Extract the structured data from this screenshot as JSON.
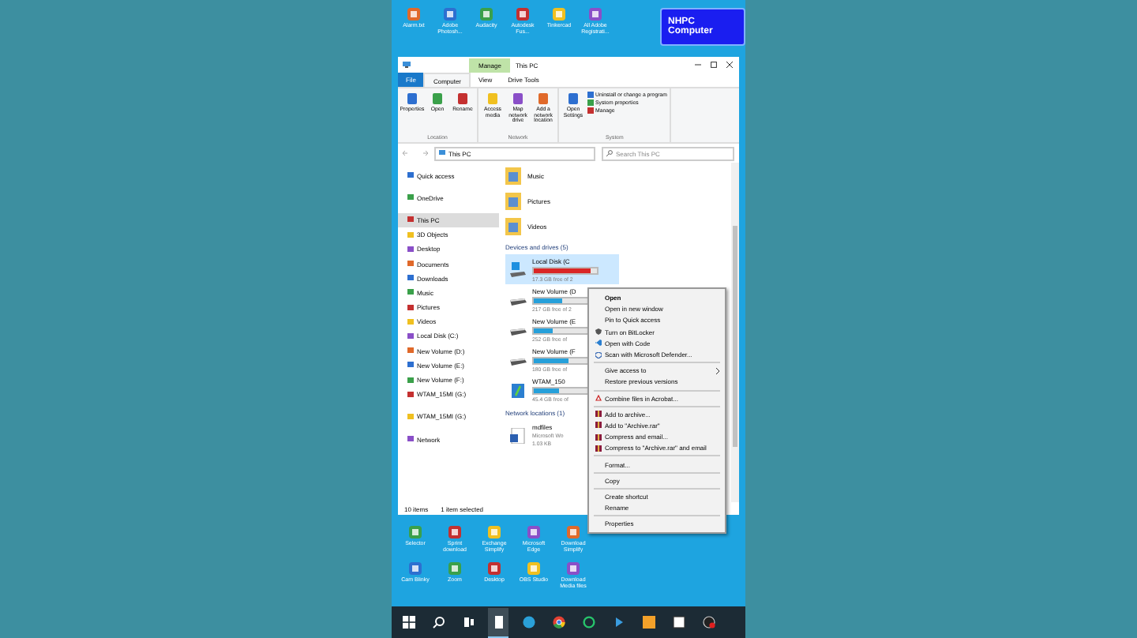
{
  "badge": "NHPC Computer",
  "desktop_top": [
    {
      "label": "Alarm.txt"
    },
    {
      "label": "Adobe Photosh..."
    },
    {
      "label": "Audacity"
    },
    {
      "label": "Autodesk Fus..."
    },
    {
      "label": "Tinkercad"
    },
    {
      "label": "All Adobe Registrati..."
    }
  ],
  "window": {
    "title": "This PC",
    "context_tab": "Manage",
    "tabs": [
      {
        "label": "File",
        "selected": false,
        "kind": "file"
      },
      {
        "label": "Computer",
        "selected": true,
        "kind": "tab"
      },
      {
        "label": "View",
        "selected": false,
        "kind": "tab"
      },
      {
        "label": "Drive Tools",
        "selected": false,
        "kind": "tab"
      }
    ],
    "ribbon_groups": [
      {
        "name": "Location",
        "buttons": [
          "Properties",
          "Open",
          "Rename"
        ]
      },
      {
        "name": "Network",
        "buttons": [
          "Access media",
          "Map network drive",
          "Add a network location"
        ]
      },
      {
        "name": "System",
        "buttons": [
          "Open Settings"
        ],
        "links": [
          "Uninstall or change a program",
          "System properties",
          "Manage"
        ]
      }
    ],
    "address": "This PC",
    "search": {
      "placeholder": "Search This PC"
    },
    "nav": [
      {
        "label": "Quick access",
        "selected": false
      },
      {
        "label": "OneDrive",
        "selected": false
      },
      {
        "label": "This PC",
        "selected": true
      },
      {
        "label": "3D Objects",
        "selected": false
      },
      {
        "label": "Desktop",
        "selected": false
      },
      {
        "label": "Documents",
        "selected": false
      },
      {
        "label": "Downloads",
        "selected": false
      },
      {
        "label": "Music",
        "selected": false
      },
      {
        "label": "Pictures",
        "selected": false
      },
      {
        "label": "Videos",
        "selected": false
      },
      {
        "label": "Local Disk (C:)",
        "selected": false
      },
      {
        "label": "New Volume (D:)",
        "selected": false
      },
      {
        "label": "New Volume (E:)",
        "selected": false
      },
      {
        "label": "New Volume (F:)",
        "selected": false
      },
      {
        "label": "WTAM_15MI (G:)",
        "selected": false
      },
      {
        "label": "WTAM_15MI (G:)",
        "selected": false
      },
      {
        "label": "Network",
        "selected": false
      }
    ],
    "folders": [
      {
        "label": "Music"
      },
      {
        "label": "Pictures"
      },
      {
        "label": "Videos"
      }
    ],
    "drives_heading": "Devices and drives (5)",
    "drives": [
      {
        "name": "Local Disk (C",
        "free": "17.3 GB free of 2",
        "level": 0.9,
        "selected": true,
        "kind": "system"
      },
      {
        "name": "New Volume (D",
        "free": "217 GB free of 2",
        "level": 0.45,
        "selected": false,
        "kind": "disk"
      },
      {
        "name": "New Volume (E",
        "free": "252 GB free of",
        "level": 0.3,
        "selected": false,
        "kind": "disk"
      },
      {
        "name": "New Volume (F",
        "free": "180 GB free of",
        "level": 0.55,
        "selected": false,
        "kind": "disk"
      },
      {
        "name": "WTAM_150",
        "free": "45.4 GB free of",
        "level": 0.4,
        "selected": false,
        "kind": "usb"
      }
    ],
    "network_heading": "Network locations (1)",
    "network": [
      {
        "name": "mdfiles",
        "type": "Microsoft Wo",
        "size": "1.03 KB"
      }
    ],
    "status": [
      "10 items",
      "1 item selected"
    ]
  },
  "menu": [
    {
      "label": "Open",
      "kind": "default"
    },
    {
      "label": "Open in new window",
      "kind": "item"
    },
    {
      "label": "Pin to Quick access",
      "kind": "item"
    },
    {
      "label": "Turn on BitLocker",
      "kind": "shield"
    },
    {
      "label": "Open with Code",
      "kind": "code"
    },
    {
      "label": "Scan with Microsoft Defender...",
      "kind": "defender"
    },
    {
      "kind": "separator"
    },
    {
      "label": "Give access to",
      "kind": "submenu"
    },
    {
      "label": "Restore previous versions",
      "kind": "item"
    },
    {
      "kind": "separator"
    },
    {
      "label": "Combine files in Acrobat...",
      "kind": "acrobat"
    },
    {
      "kind": "separator"
    },
    {
      "label": "Add to archive...",
      "kind": "archive"
    },
    {
      "label": "Add to \"Archive.rar\"",
      "kind": "archive"
    },
    {
      "label": "Compress and email...",
      "kind": "archive"
    },
    {
      "label": "Compress to \"Archive.rar\" and email",
      "kind": "archive"
    },
    {
      "kind": "separator"
    },
    {
      "label": "Format...",
      "kind": "item"
    },
    {
      "kind": "separator"
    },
    {
      "label": "Copy",
      "kind": "item"
    },
    {
      "kind": "separator"
    },
    {
      "label": "Create shortcut",
      "kind": "item"
    },
    {
      "label": "Rename",
      "kind": "item"
    },
    {
      "kind": "separator"
    },
    {
      "label": "Properties",
      "kind": "item"
    }
  ],
  "desktop_bottom": [
    [
      {
        "label": "Selector"
      },
      {
        "label": "Sprint download"
      },
      {
        "label": "Exchange Simplify"
      },
      {
        "label": "Microsoft Edge"
      },
      {
        "label": "Download Simplify"
      }
    ],
    [
      {
        "label": "Cam Blinky"
      },
      {
        "label": "Zoom"
      },
      {
        "label": "Desktop"
      },
      {
        "label": "OBS Studio"
      },
      {
        "label": "Download Media files"
      }
    ]
  ],
  "taskbar": [
    {
      "kind": "start",
      "selected": false
    },
    {
      "kind": "search",
      "selected": false
    },
    {
      "kind": "taskview",
      "selected": false
    },
    {
      "kind": "files",
      "selected": true
    },
    {
      "kind": "edge",
      "selected": false
    },
    {
      "kind": "chrome",
      "selected": false
    },
    {
      "kind": "ring",
      "selected": false
    },
    {
      "kind": "arrow",
      "selected": false
    },
    {
      "kind": "orange",
      "selected": false
    },
    {
      "kind": "white",
      "selected": false
    },
    {
      "kind": "record",
      "selected": false
    }
  ]
}
